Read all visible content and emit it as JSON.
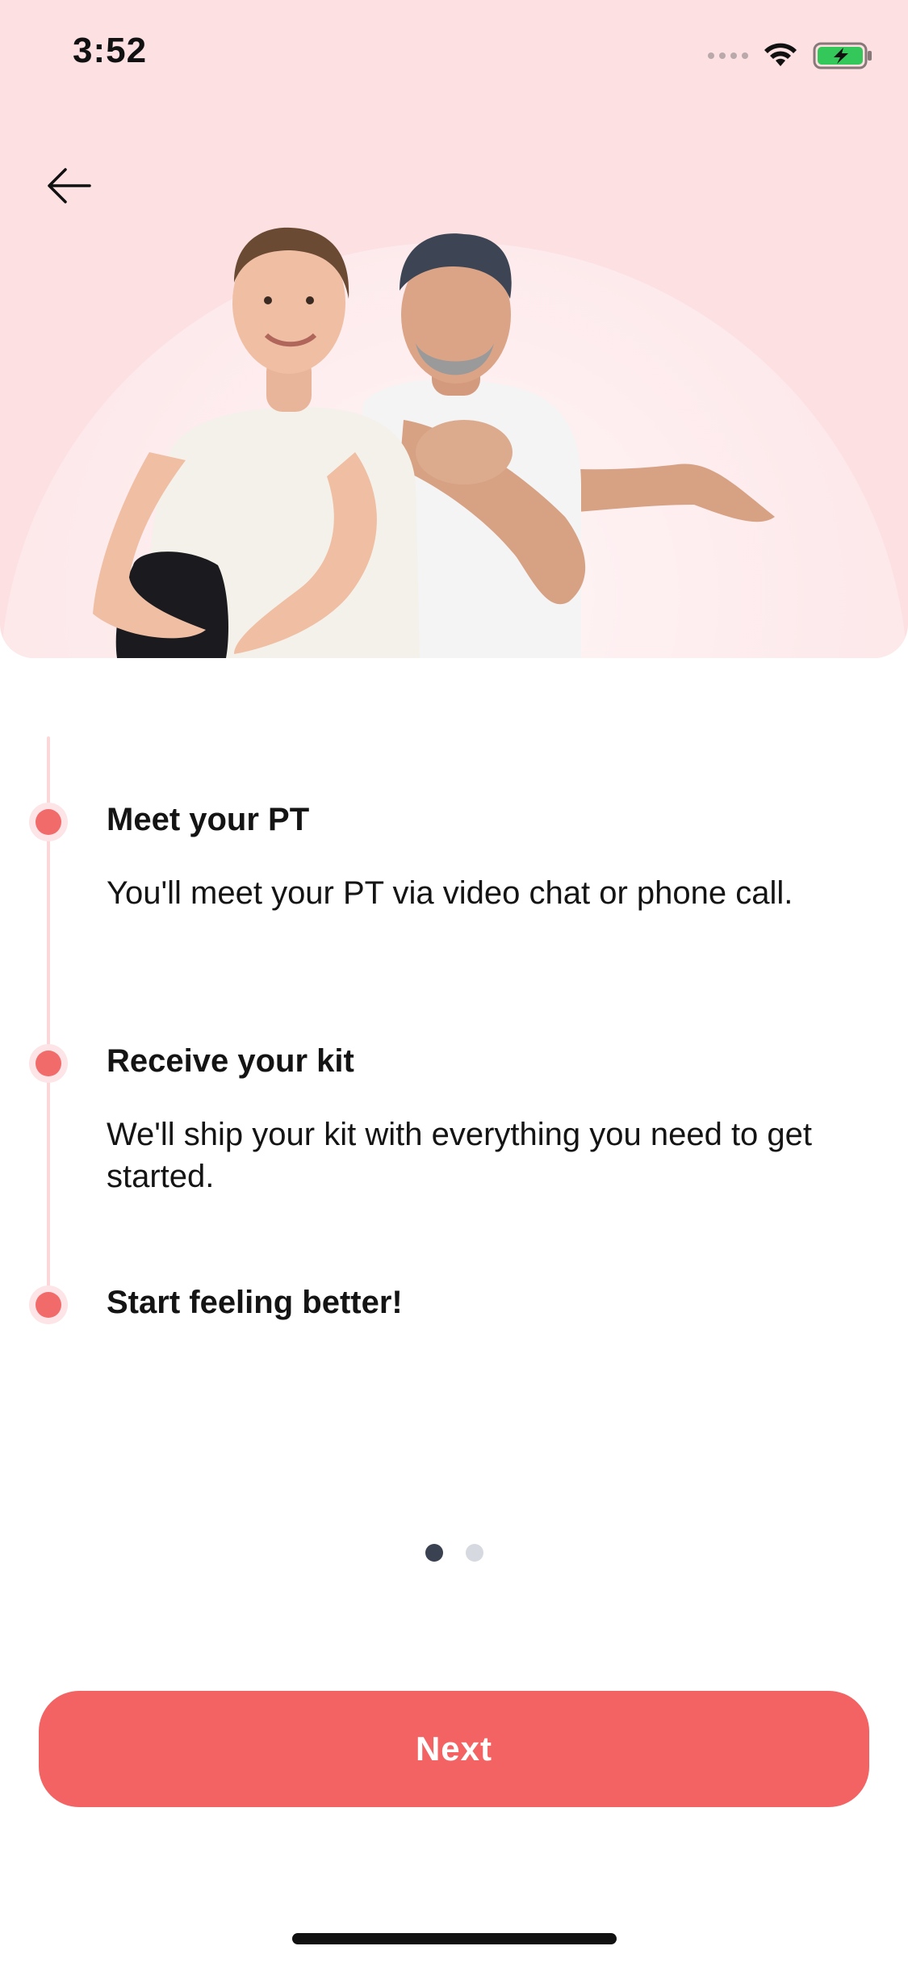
{
  "status_bar": {
    "time": "3:52",
    "signal_icon": "cellular-signal-icon",
    "wifi_icon": "wifi-icon",
    "battery_icon": "battery-charging-icon",
    "battery_color": "#34c759"
  },
  "header": {
    "back_icon": "arrow-left-icon"
  },
  "steps": [
    {
      "title": "Meet your PT",
      "description": "You'll meet your PT via video chat or phone call."
    },
    {
      "title": "Receive your kit",
      "description": "We'll ship your kit with everything you need to get started."
    },
    {
      "title": "Start feeling better!",
      "description": ""
    }
  ],
  "pagination": {
    "total": 2,
    "active_index": 0
  },
  "cta": {
    "next_label": "Next"
  },
  "colors": {
    "accent": "#f36363",
    "hero_background": "#fde0e2",
    "timeline": "#fbd7da",
    "pager_active": "#3a4150",
    "pager_inactive": "#d6dae0"
  }
}
